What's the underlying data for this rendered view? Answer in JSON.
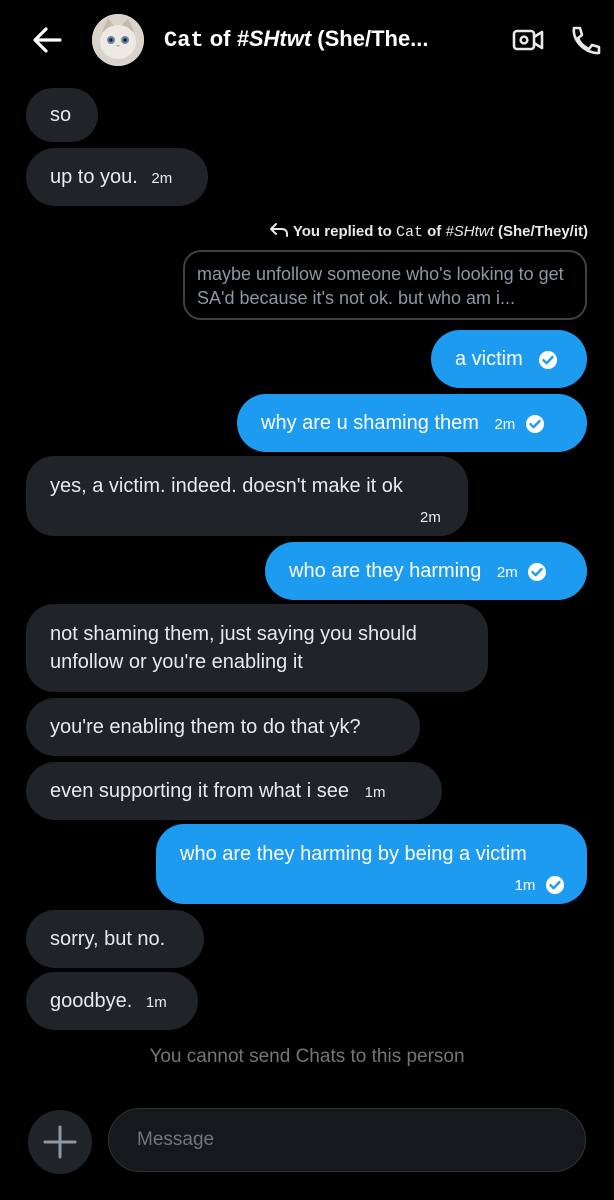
{
  "header": {
    "title_part1": "Cat",
    "title_part2": " of ",
    "title_part3": "#SHtwt",
    "title_part4": " (She/The..."
  },
  "reply_banner": {
    "prefix": "You replied to ",
    "name_part1": "Cat",
    "name_part2": " of ",
    "name_part3": "#SHtwt",
    "name_part4": " (She/They/it)",
    "quote": "maybe unfollow someone who's looking to get SA'd because it's not ok. but who am i..."
  },
  "messages": [
    {
      "text": "so",
      "time": ""
    },
    {
      "text": "up to you.",
      "time": "2m"
    },
    {
      "text": "a victim",
      "time": ""
    },
    {
      "text": "why are u shaming them",
      "time": "2m"
    },
    {
      "text": "yes, a victim. indeed. doesn't make it ok",
      "time": "2m"
    },
    {
      "text": "who are they harming",
      "time": "2m"
    },
    {
      "text": "not shaming them, just saying you should unfollow or you're enabling it",
      "time": ""
    },
    {
      "text": "you're enabling them to do that yk?",
      "time": ""
    },
    {
      "text": "even supporting it from what i see",
      "time": "1m"
    },
    {
      "text": "who are they harming by being a victim",
      "time": "1m"
    },
    {
      "text": "sorry, but no.",
      "time": ""
    },
    {
      "text": "goodbye.",
      "time": "1m"
    }
  ],
  "notice": "You cannot send Chats to this person",
  "composer": {
    "placeholder": "Message"
  },
  "colors": {
    "sent_bubble": "#1d9bf0",
    "received_bubble": "#202327",
    "background": "#000000"
  }
}
